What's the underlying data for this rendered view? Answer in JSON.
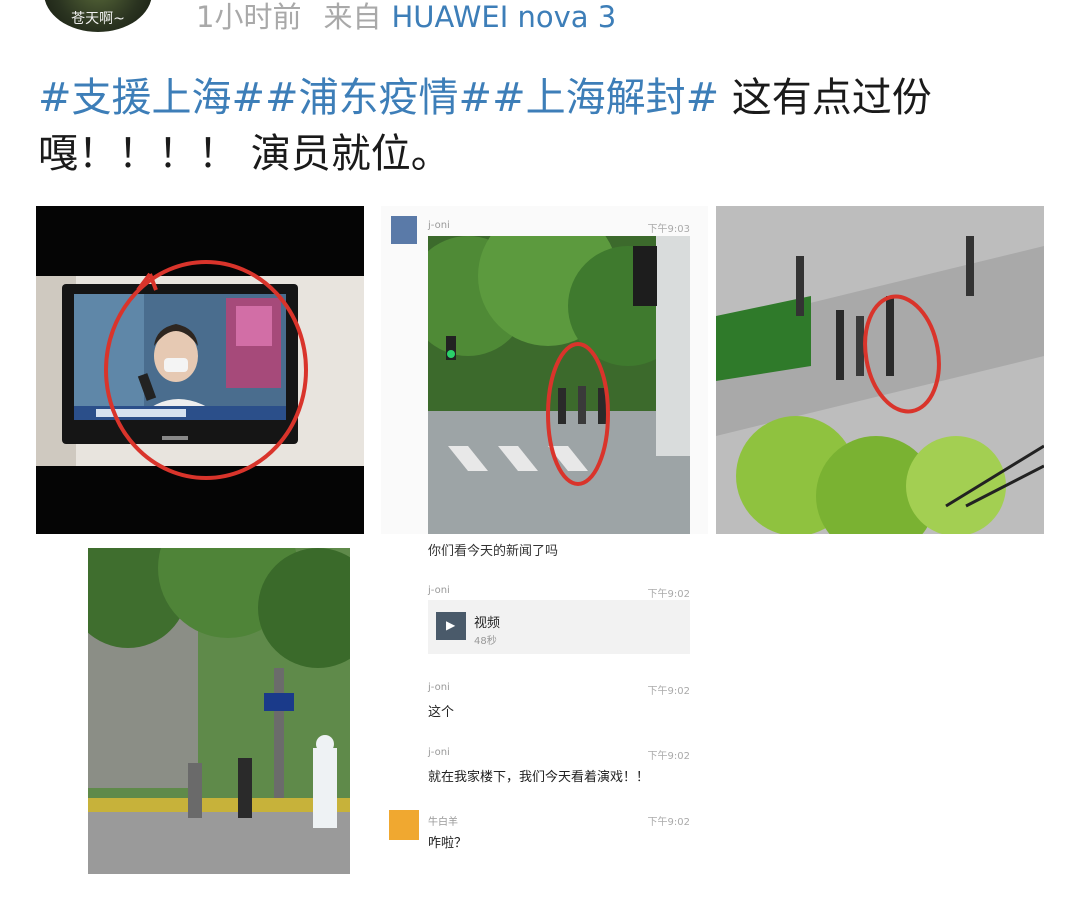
{
  "header": {
    "avatar_name": "苍天啊~",
    "time": "1小时前",
    "source_prefix": "来自",
    "device": "HUAWEI nova 3"
  },
  "post": {
    "tags": [
      "#支援上海#",
      "#浦东疫情#",
      "#上海解封#"
    ],
    "text": " 这有点过份嘎！！！！ 演员就位。"
  },
  "photos": {
    "screenshot_top": {
      "sender": "j-oni",
      "time": "下午9:03"
    },
    "chat": {
      "partial_line": "你们看今天的新闻了吗",
      "messages": [
        {
          "sender": "j-oni",
          "time": "下午9:02",
          "video_label": "视频",
          "video_duration": "48秒"
        },
        {
          "sender": "j-oni",
          "time": "下午9:02",
          "text": "这个"
        },
        {
          "sender": "j-oni",
          "time": "下午9:02",
          "text": "就在我家楼下，我们今天看着演戏！！"
        },
        {
          "sender": "牛白羊",
          "time": "下午9:02",
          "text": "咋啦？"
        }
      ]
    }
  },
  "colors": {
    "link": "#3d7eb8",
    "meta": "#a9a9a9",
    "annotation_red": "#d9342b"
  }
}
